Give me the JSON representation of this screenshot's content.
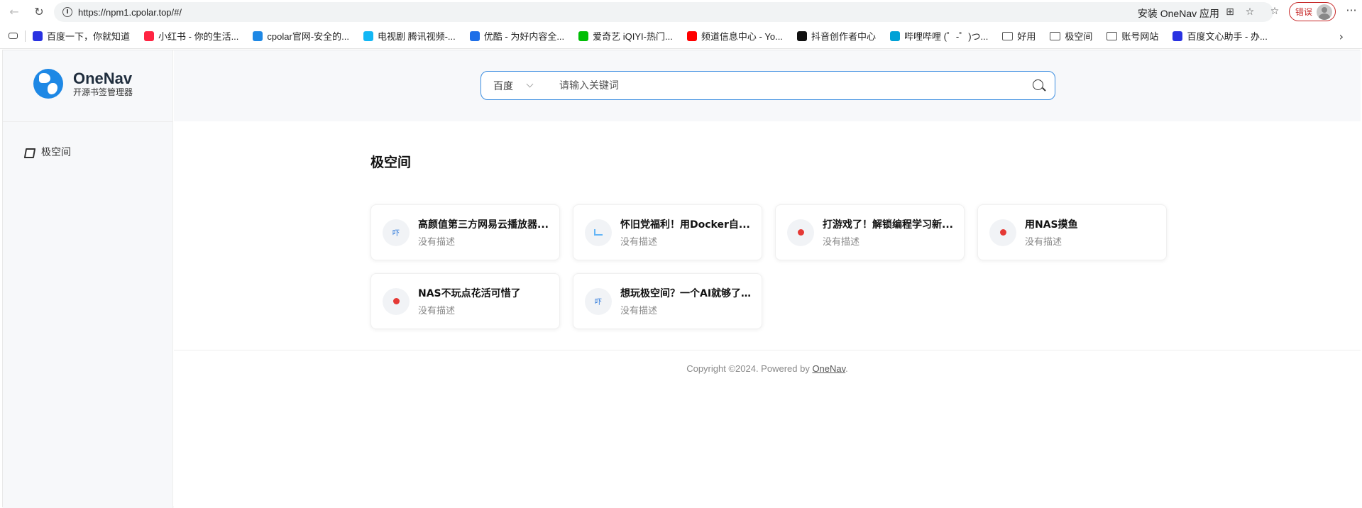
{
  "browser": {
    "url": "https://npm1.cpolar.top/#/",
    "install_label": "安装 OneNav 应用",
    "error_label": "错误",
    "more_label": "···"
  },
  "bookmarks": {
    "items": [
      {
        "label": "百度一下，你就知道",
        "color": "#2932e1"
      },
      {
        "label": "小红书 - 你的生活...",
        "color": "#ff2442"
      },
      {
        "label": "cpolar官网-安全的...",
        "color": "#1e88e5"
      },
      {
        "label": "电视剧 腾讯视频-...",
        "color": "#12b7f5"
      },
      {
        "label": "优酷 - 为好内容全...",
        "color": "#1e6fe8"
      },
      {
        "label": "爱奇艺 iQIYI-热门...",
        "color": "#00be06"
      },
      {
        "label": "频道信息中心 - Yo...",
        "color": "#ff0000"
      },
      {
        "label": "抖音创作者中心",
        "color": "#111111"
      },
      {
        "label": "哔哩哔哩 (゜-゜)つ...",
        "color": "#00a1d6"
      }
    ],
    "folders": [
      "好用",
      "极空间",
      "账号网站"
    ],
    "last": {
      "label": "百度文心助手 - 办...",
      "color": "#2932e1"
    }
  },
  "app": {
    "name": "OneNav",
    "subtitle": "开源书签管理器",
    "sidebar_items": [
      "极空间"
    ],
    "search": {
      "engine": "百度",
      "placeholder": "请输入关键词"
    },
    "section_title": "极空间",
    "cards": [
      {
        "title": "高颜值第三方网易云播放器...",
        "desc": "没有描述",
        "icon": "text-blue"
      },
      {
        "title": "怀旧党福利！用Docker自...",
        "desc": "没有描述",
        "icon": "bars"
      },
      {
        "title": "打游戏了！解锁编程学习新...",
        "desc": "没有描述",
        "icon": "red-dot"
      },
      {
        "title": "用NAS摸鱼",
        "desc": "没有描述",
        "icon": "red-dot"
      },
      {
        "title": "NAS不玩点花活可惜了",
        "desc": "没有描述",
        "icon": "red-dot"
      },
      {
        "title": "想玩极空间？一个AI就够了...",
        "desc": "没有描述",
        "icon": "text-blue"
      }
    ],
    "card_icon_text": "吓",
    "footer": {
      "prefix": "Copyright ©2024. Powered by ",
      "link": "OneNav",
      "suffix": "."
    }
  }
}
